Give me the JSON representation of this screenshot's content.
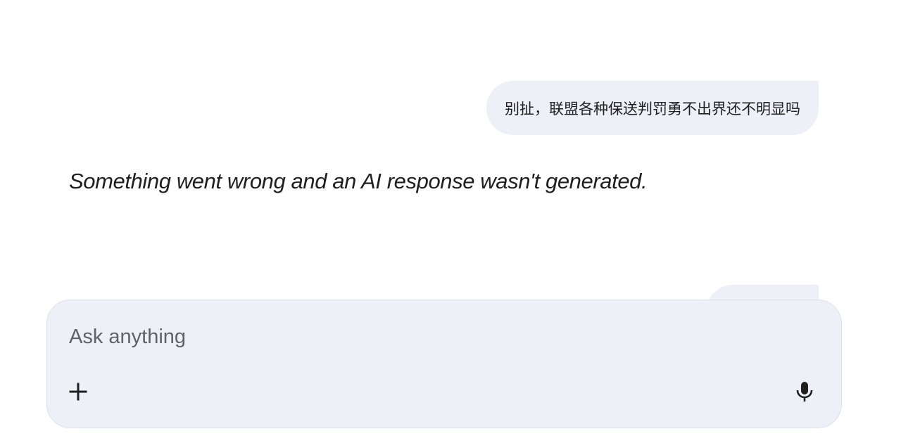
{
  "conversation": {
    "user_message": "别扯，联盟各种保送判罚勇不出界还不明显吗",
    "ai_response": "Something went wrong and an AI response wasn't generated."
  },
  "composer": {
    "placeholder": "Ask anything",
    "value": "",
    "add_icon": "plus-icon",
    "mic_icon": "microphone-icon"
  },
  "colors": {
    "bubble_background": "#eef0f7",
    "composer_background": "#eef0f8",
    "text": "#1f1f1f",
    "placeholder": "#5f6368"
  }
}
